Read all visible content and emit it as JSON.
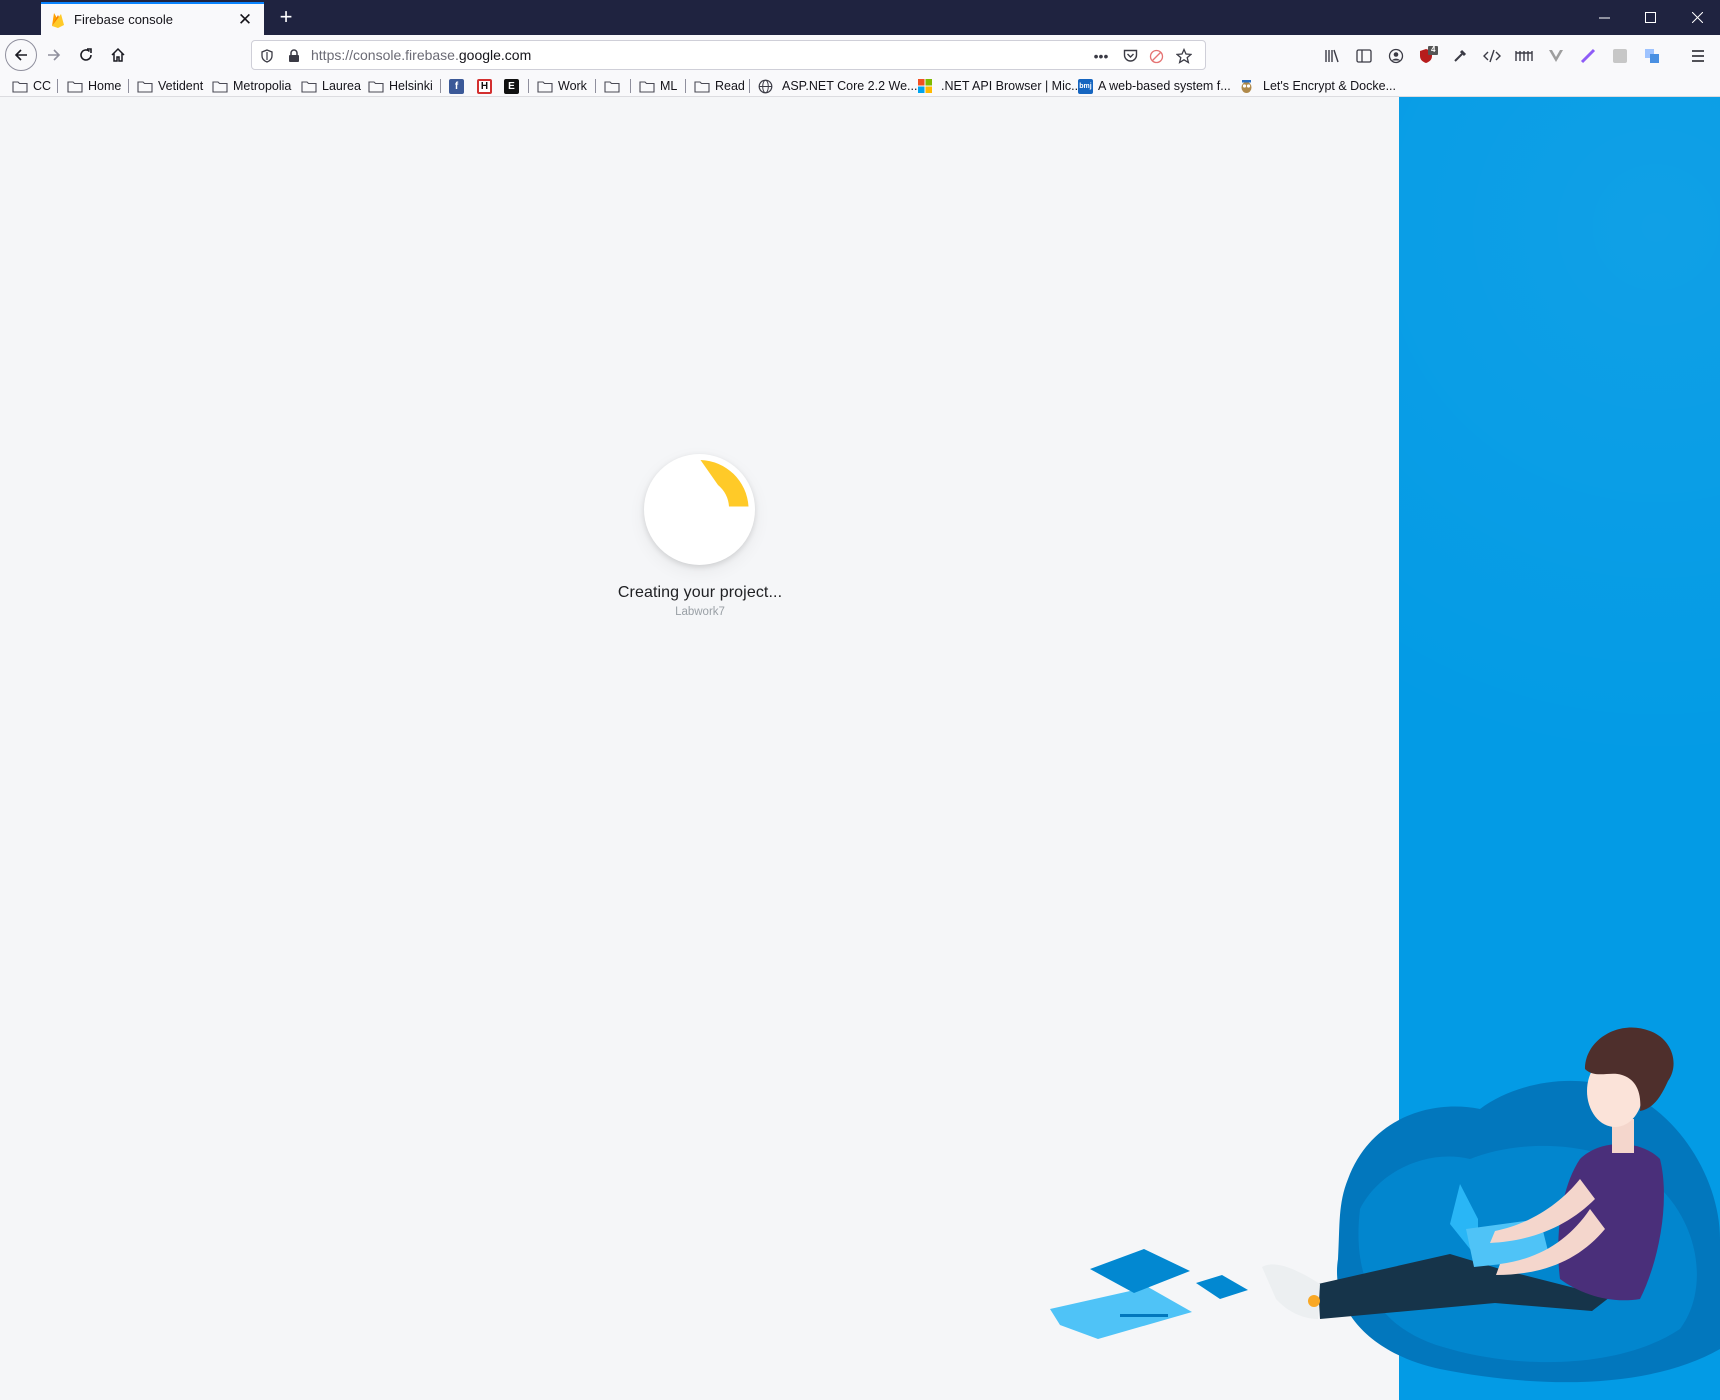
{
  "browser": {
    "tab": {
      "title": "Firebase console"
    },
    "url": {
      "prefix": "https://console.firebase.",
      "domain": "google.com"
    },
    "badge_count": "4"
  },
  "bookmarks": [
    {
      "label": "CC",
      "type": "folder"
    },
    {
      "label": "Home",
      "type": "folder"
    },
    {
      "label": "Vetident",
      "type": "folder"
    },
    {
      "label": "Metropolia",
      "type": "folder"
    },
    {
      "label": "Laurea",
      "type": "folder"
    },
    {
      "label": "Helsinki",
      "type": "folder"
    },
    {
      "label": "Work",
      "type": "folder"
    },
    {
      "label": "ML",
      "type": "folder"
    },
    {
      "label": "Read",
      "type": "folder"
    },
    {
      "label": "ASP.NET Core 2.2 We...",
      "type": "link"
    },
    {
      "label": ".NET API Browser | Mic...",
      "type": "link"
    },
    {
      "label": "A web-based system f...",
      "type": "link"
    },
    {
      "label": "Let's Encrypt & Docke...",
      "type": "link"
    }
  ],
  "page": {
    "status_title": "Creating your project...",
    "project_name": "Labwork7"
  },
  "colors": {
    "accent_blue": "#039be5",
    "firebase_yellow": "#ffca28",
    "titlebar": "#1f2340"
  }
}
